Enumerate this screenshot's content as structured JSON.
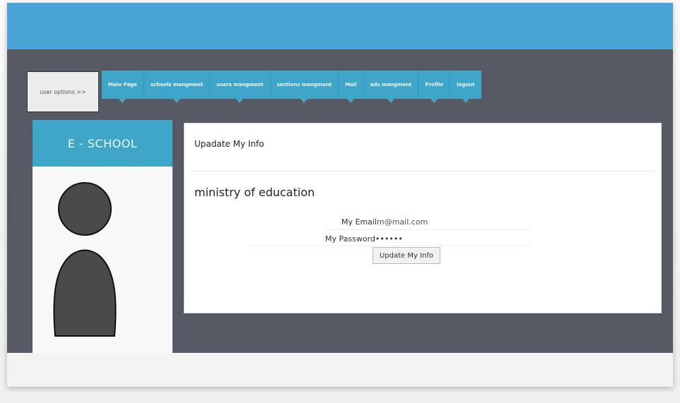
{
  "user_options": {
    "label": "user options >>"
  },
  "nav": {
    "items": [
      {
        "label": "Main Page"
      },
      {
        "label": "schools mangment"
      },
      {
        "label": "users mangment"
      },
      {
        "label": "sections mangment"
      },
      {
        "label": "Mail"
      },
      {
        "label": "ads mangment"
      },
      {
        "label": "Profile"
      },
      {
        "label": "logout"
      }
    ]
  },
  "sidebar": {
    "title": "E - SCHOOL"
  },
  "main": {
    "title": "Upadate My Info",
    "org_name": "ministry of education",
    "email_label": "My Email",
    "email_value": "m@mail.com",
    "password_label": "My Password",
    "password_value": "••••••",
    "update_button": "Update My Info"
  },
  "colors": {
    "top_band": "#4aa3d5",
    "dark_bg": "#575a65",
    "accent": "#3fa6c9",
    "avatar": "#4a4a4a"
  }
}
